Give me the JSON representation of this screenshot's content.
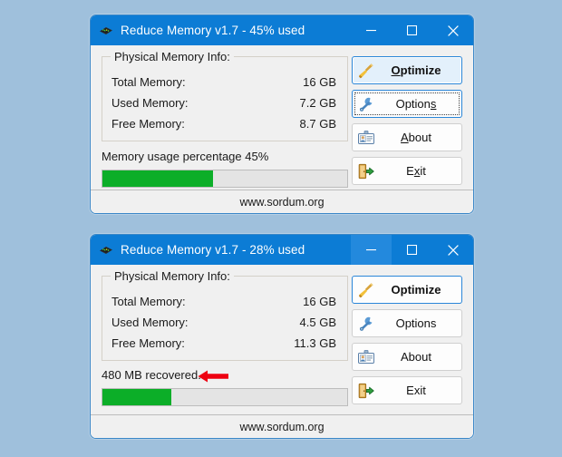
{
  "desktop": {
    "background_color": "#9fc0dc"
  },
  "windows": [
    {
      "id": "window-1",
      "title": "Reduce Memory v1.7 - 45% used",
      "icon": "memory-module-icon",
      "titlebar_color": "#0c7cd5",
      "controls": {
        "minimize": "minimize-icon",
        "maximize": "maximize-icon",
        "close": "close-icon",
        "hovered": "none"
      },
      "groupbox": {
        "label": "Physical Memory Info:",
        "rows": [
          {
            "label": "Total Memory:",
            "value": "16 GB"
          },
          {
            "label": "Used Memory:",
            "value": "7.2 GB"
          },
          {
            "label": "Free Memory:",
            "value": "8.7 GB"
          }
        ]
      },
      "status_text": "Memory usage percentage 45%",
      "progress": {
        "percent": 45,
        "fill_color": "#0cae28",
        "track_color": "#e4e4e4"
      },
      "annotation": null,
      "buttons": [
        {
          "label": "Optimize",
          "icon": "broom-icon",
          "mnemonic": "O",
          "style": "primary",
          "bold": true
        },
        {
          "label": "Options",
          "icon": "wrench-icon",
          "mnemonic": "s",
          "style": "focus-dotted",
          "bold": false
        },
        {
          "label": "About",
          "icon": "id-badge-icon",
          "mnemonic": "A",
          "style": "normal",
          "bold": false
        },
        {
          "label": "Exit",
          "icon": "exit-door-icon",
          "mnemonic": "x",
          "style": "normal",
          "bold": false
        }
      ],
      "statusbar": "www.sordum.org"
    },
    {
      "id": "window-2",
      "title": "Reduce Memory v1.7 - 28% used",
      "icon": "memory-module-icon",
      "titlebar_color": "#0c7cd5",
      "controls": {
        "minimize": "minimize-icon",
        "maximize": "maximize-icon",
        "close": "close-icon",
        "hovered": "minimize"
      },
      "groupbox": {
        "label": "Physical Memory Info:",
        "rows": [
          {
            "label": "Total Memory:",
            "value": "16 GB"
          },
          {
            "label": "Used Memory:",
            "value": "4.5 GB"
          },
          {
            "label": "Free Memory:",
            "value": "11.3 GB"
          }
        ]
      },
      "status_text": "480 MB recovered.",
      "progress": {
        "percent": 28,
        "fill_color": "#0cae28",
        "track_color": "#e4e4e4"
      },
      "annotation": {
        "type": "arrow-left",
        "color": "#ee0011"
      },
      "buttons": [
        {
          "label": "Optimize",
          "icon": "broom-icon",
          "mnemonic": "",
          "style": "primary-plain",
          "bold": true
        },
        {
          "label": "Options",
          "icon": "wrench-icon",
          "mnemonic": "",
          "style": "normal",
          "bold": false
        },
        {
          "label": "About",
          "icon": "id-badge-icon",
          "mnemonic": "",
          "style": "normal",
          "bold": false
        },
        {
          "label": "Exit",
          "icon": "exit-door-icon",
          "mnemonic": "",
          "style": "normal",
          "bold": false
        }
      ],
      "statusbar": "www.sordum.org"
    }
  ]
}
